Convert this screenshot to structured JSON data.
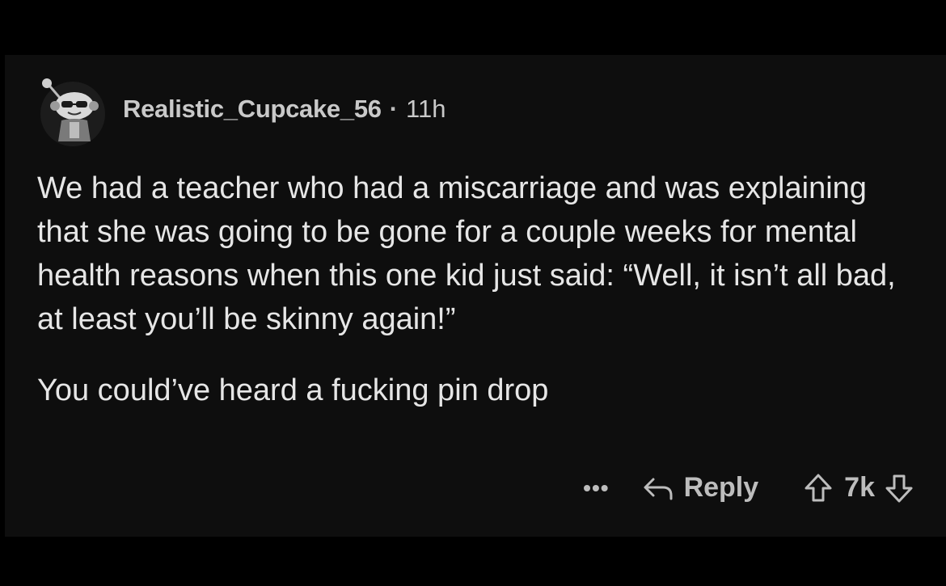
{
  "comment": {
    "author": "Realistic_Cupcake_56",
    "separator": "·",
    "age": "11h",
    "paragraphs": [
      "We had a teacher who had a miscarriage and was explaining that she was going to be gone for a couple weeks for mental health reasons when this one kid just said: “Well, it isn’t all bad, at least you’ll be skinny again!”",
      "You could’ve heard a fucking pin drop"
    ]
  },
  "actions": {
    "more_label": "•••",
    "reply_label": "Reply",
    "score": "7k"
  },
  "icons": {
    "avatar": "snoo-avatar-icon",
    "reply": "reply-arrow-icon",
    "upvote": "upvote-arrow-icon",
    "downvote": "downvote-arrow-icon"
  },
  "colors": {
    "background": "#000000",
    "card": "#0e0e0e",
    "text": "#e6e6e6",
    "muted": "#bdbdbd"
  }
}
